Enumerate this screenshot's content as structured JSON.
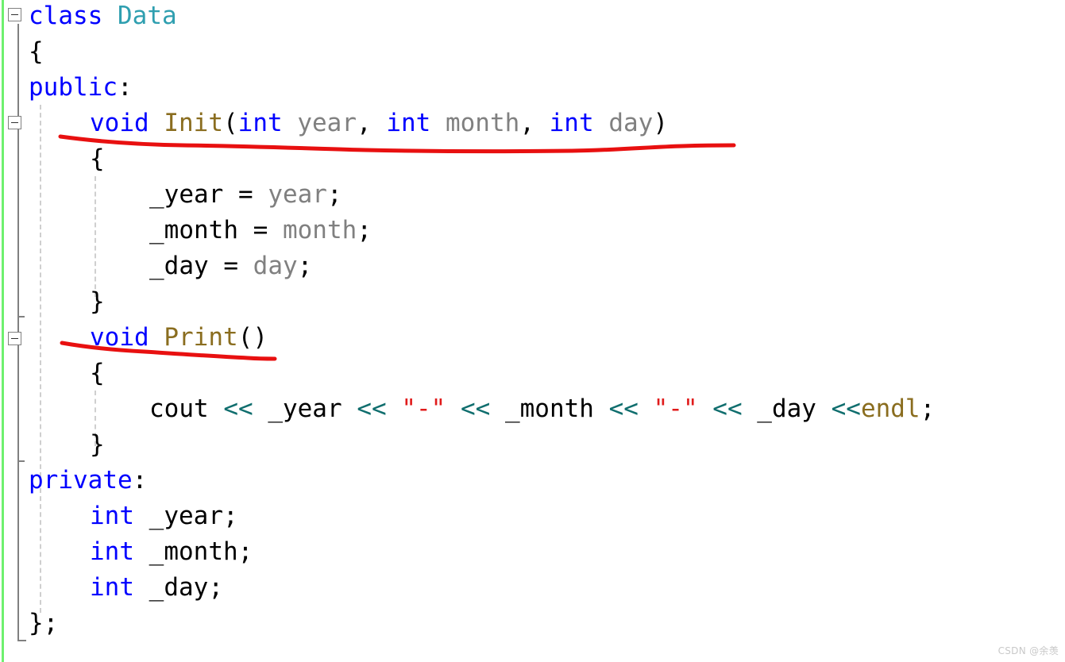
{
  "editor": {
    "background_color": "#ffffff",
    "change_stripe_color": "#6ef06e",
    "gutter_color": "#808080",
    "indent_guide_color": "#cfcfcf",
    "annotation_color": "#e01b1b",
    "language": "C++",
    "colors": {
      "keyword": "#0000ff",
      "class_name": "#2f9fb0",
      "function_name": "#8a6d1f",
      "parameter": "#808080",
      "plain": "#000000",
      "operator": "#106e6e",
      "string": "#e01b1b"
    },
    "fold_markers": [
      {
        "name": "fold-marker-class",
        "line": 1
      },
      {
        "name": "fold-marker-init",
        "line": 4
      },
      {
        "name": "fold-marker-print",
        "line": 10
      }
    ],
    "lines": [
      {
        "number": 1,
        "indent": 0,
        "tokens": [
          {
            "text": "class",
            "kind": "keyword"
          },
          {
            "text": " ",
            "kind": "plain"
          },
          {
            "text": "Data",
            "kind": "class_name"
          }
        ]
      },
      {
        "number": 2,
        "indent": 0,
        "tokens": [
          {
            "text": "{",
            "kind": "plain"
          }
        ]
      },
      {
        "number": 3,
        "indent": 0,
        "tokens": [
          {
            "text": "public",
            "kind": "keyword"
          },
          {
            "text": ":",
            "kind": "plain"
          }
        ]
      },
      {
        "number": 4,
        "indent": 1,
        "tokens": [
          {
            "text": "void",
            "kind": "keyword"
          },
          {
            "text": " ",
            "kind": "plain"
          },
          {
            "text": "Init",
            "kind": "function_name"
          },
          {
            "text": "(",
            "kind": "plain"
          },
          {
            "text": "int",
            "kind": "keyword"
          },
          {
            "text": " ",
            "kind": "plain"
          },
          {
            "text": "year",
            "kind": "parameter"
          },
          {
            "text": ", ",
            "kind": "plain"
          },
          {
            "text": "int",
            "kind": "keyword"
          },
          {
            "text": " ",
            "kind": "plain"
          },
          {
            "text": "month",
            "kind": "parameter"
          },
          {
            "text": ", ",
            "kind": "plain"
          },
          {
            "text": "int",
            "kind": "keyword"
          },
          {
            "text": " ",
            "kind": "plain"
          },
          {
            "text": "day",
            "kind": "parameter"
          },
          {
            "text": ")",
            "kind": "plain"
          }
        ]
      },
      {
        "number": 5,
        "indent": 1,
        "tokens": [
          {
            "text": "{",
            "kind": "plain"
          }
        ]
      },
      {
        "number": 6,
        "indent": 2,
        "tokens": [
          {
            "text": "_year = ",
            "kind": "plain"
          },
          {
            "text": "year",
            "kind": "parameter"
          },
          {
            "text": ";",
            "kind": "plain"
          }
        ]
      },
      {
        "number": 7,
        "indent": 2,
        "tokens": [
          {
            "text": "_month = ",
            "kind": "plain"
          },
          {
            "text": "month",
            "kind": "parameter"
          },
          {
            "text": ";",
            "kind": "plain"
          }
        ]
      },
      {
        "number": 8,
        "indent": 2,
        "tokens": [
          {
            "text": "_day = ",
            "kind": "plain"
          },
          {
            "text": "day",
            "kind": "parameter"
          },
          {
            "text": ";",
            "kind": "plain"
          }
        ]
      },
      {
        "number": 9,
        "indent": 1,
        "tokens": [
          {
            "text": "}",
            "kind": "plain"
          }
        ]
      },
      {
        "number": 10,
        "indent": 1,
        "tokens": [
          {
            "text": "void",
            "kind": "keyword"
          },
          {
            "text": " ",
            "kind": "plain"
          },
          {
            "text": "Print",
            "kind": "function_name"
          },
          {
            "text": "()",
            "kind": "plain"
          }
        ]
      },
      {
        "number": 11,
        "indent": 1,
        "tokens": [
          {
            "text": "{",
            "kind": "plain"
          }
        ]
      },
      {
        "number": 12,
        "indent": 2,
        "tokens": [
          {
            "text": "cout ",
            "kind": "plain"
          },
          {
            "text": "<<",
            "kind": "operator"
          },
          {
            "text": " _year ",
            "kind": "plain"
          },
          {
            "text": "<<",
            "kind": "operator"
          },
          {
            "text": " ",
            "kind": "plain"
          },
          {
            "text": "\"-\"",
            "kind": "string"
          },
          {
            "text": " ",
            "kind": "plain"
          },
          {
            "text": "<<",
            "kind": "operator"
          },
          {
            "text": " _month ",
            "kind": "plain"
          },
          {
            "text": "<<",
            "kind": "operator"
          },
          {
            "text": " ",
            "kind": "plain"
          },
          {
            "text": "\"-\"",
            "kind": "string"
          },
          {
            "text": " ",
            "kind": "plain"
          },
          {
            "text": "<<",
            "kind": "operator"
          },
          {
            "text": " _day ",
            "kind": "plain"
          },
          {
            "text": "<<",
            "kind": "operator"
          },
          {
            "text": "endl",
            "kind": "function_name"
          },
          {
            "text": ";",
            "kind": "plain"
          }
        ]
      },
      {
        "number": 13,
        "indent": 1,
        "tokens": [
          {
            "text": "}",
            "kind": "plain"
          }
        ]
      },
      {
        "number": 14,
        "indent": 0,
        "tokens": [
          {
            "text": "private",
            "kind": "keyword"
          },
          {
            "text": ":",
            "kind": "plain"
          }
        ]
      },
      {
        "number": 15,
        "indent": 1,
        "tokens": [
          {
            "text": "int",
            "kind": "keyword"
          },
          {
            "text": " _year;",
            "kind": "plain"
          }
        ]
      },
      {
        "number": 16,
        "indent": 1,
        "tokens": [
          {
            "text": "int",
            "kind": "keyword"
          },
          {
            "text": " _month;",
            "kind": "plain"
          }
        ]
      },
      {
        "number": 17,
        "indent": 1,
        "tokens": [
          {
            "text": "int",
            "kind": "keyword"
          },
          {
            "text": " _day;",
            "kind": "plain"
          }
        ]
      },
      {
        "number": 18,
        "indent": 0,
        "tokens": [
          {
            "text": "};",
            "kind": "plain"
          }
        ]
      }
    ],
    "annotations": [
      {
        "name": "red-underline-init-signature",
        "target": "void Init(int year, int month, int day)"
      },
      {
        "name": "red-underline-print-signature",
        "target": "void Print()"
      }
    ]
  },
  "watermark": {
    "text": "CSDN @余羡"
  }
}
